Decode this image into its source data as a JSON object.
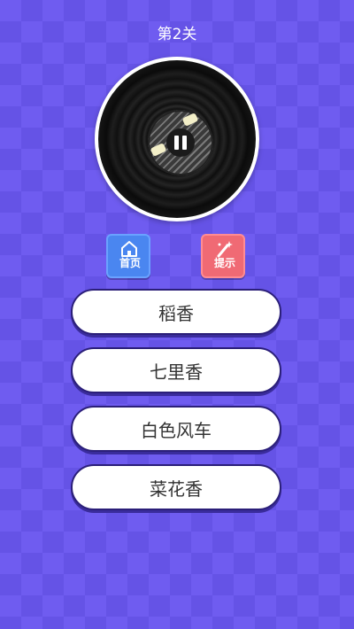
{
  "level": {
    "title": "第2关"
  },
  "player": {
    "state": "paused",
    "control_icon": "pause-icon"
  },
  "toolbar": {
    "home_label": "首页",
    "home_icon": "home-icon",
    "hint_label": "提示",
    "hint_icon": "magic-wand-icon",
    "home_color": "#4a86f0",
    "hint_color": "#f06a74"
  },
  "answers": [
    {
      "label": "稻香"
    },
    {
      "label": "七里香"
    },
    {
      "label": "白色风车"
    },
    {
      "label": "菜花香"
    }
  ],
  "colors": {
    "background": "#6f5cf0",
    "button_border": "#2b1f79"
  }
}
